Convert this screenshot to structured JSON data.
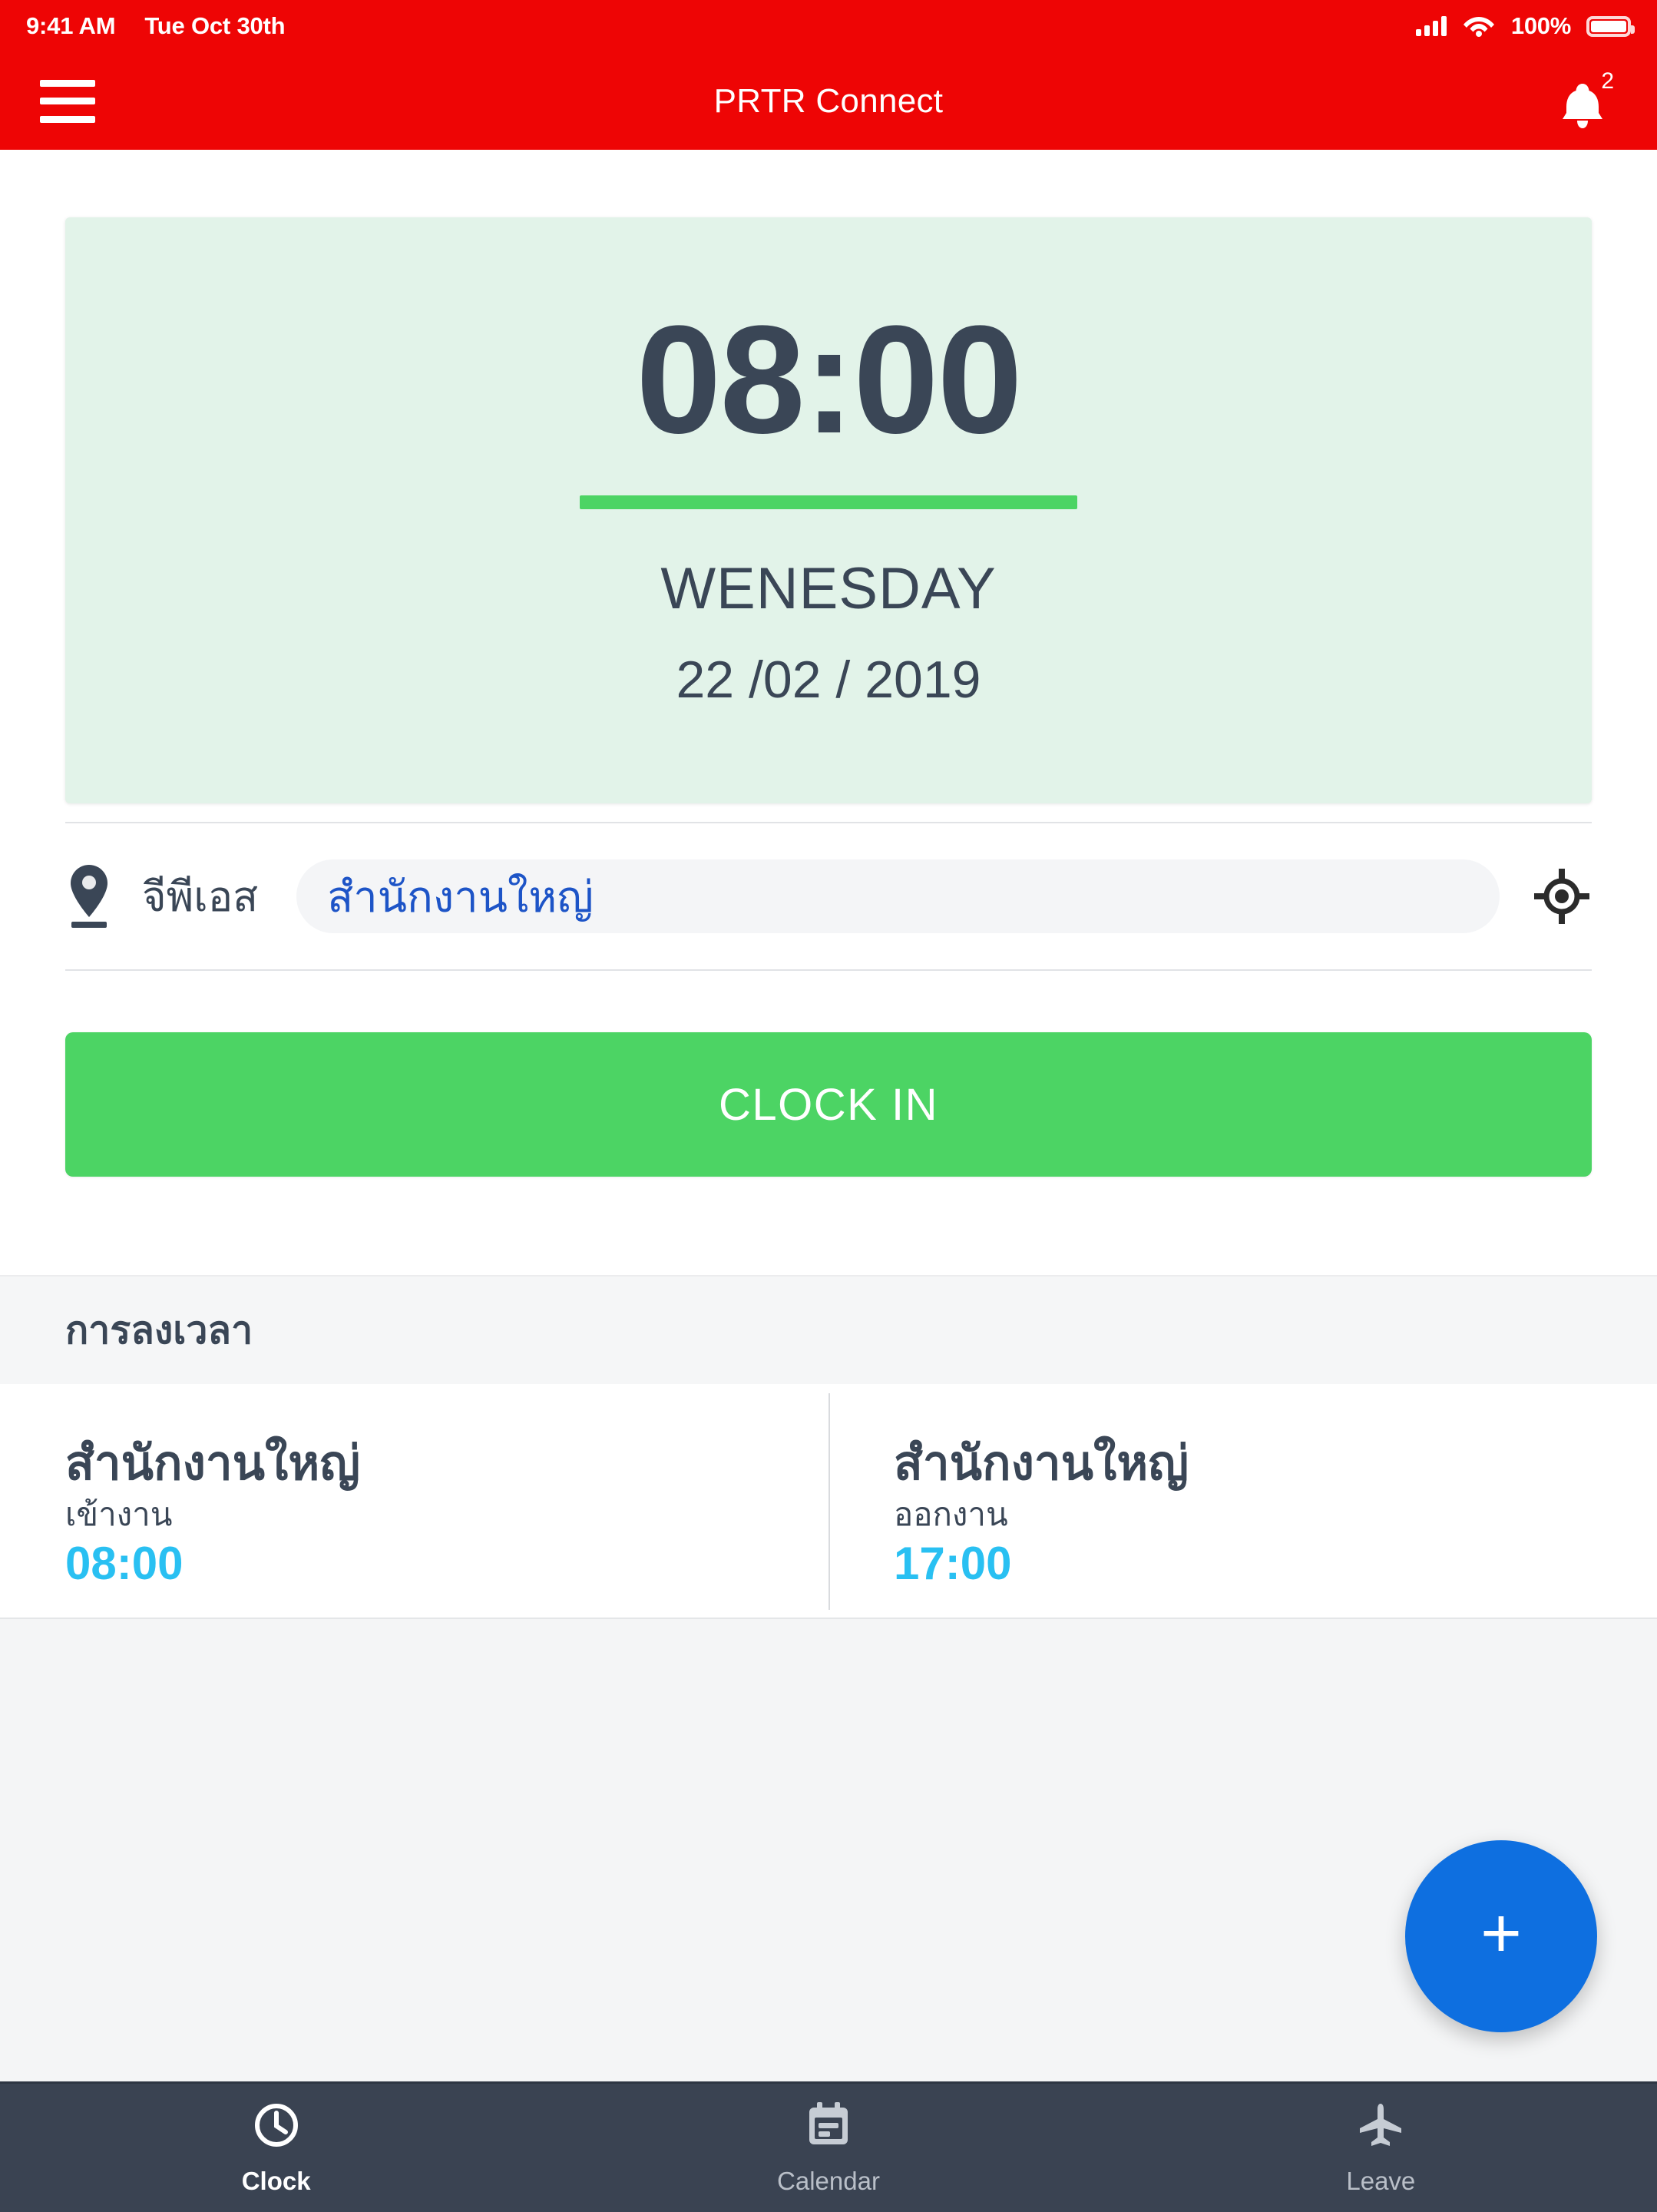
{
  "status_bar": {
    "time": "9:41 AM",
    "date": "Tue Oct 30th",
    "battery_pct": "100%",
    "signal_icon": "signal-bars-icon",
    "wifi_icon": "wifi-icon",
    "battery_icon": "battery-full-icon"
  },
  "app_bar": {
    "title": "PRTR Connect",
    "menu_icon": "hamburger-menu-icon",
    "notification_icon": "bell-icon",
    "notification_count": "2",
    "background_color": "#ee0505"
  },
  "clock_card": {
    "time": "08:00",
    "weekday": "WENESDAY",
    "date": "22 /02 / 2019",
    "background_color": "#e2f3e9",
    "accent_color": "#4cd464",
    "text_color": "#3a4656"
  },
  "gps": {
    "pin_icon": "location-pin-icon",
    "label": "จีพีเอส",
    "value": "สำนักงานใหญ่",
    "placeholder": "สำนักงานใหญ่",
    "value_color": "#1d54c7",
    "locate_icon": "gps-crosshair-icon"
  },
  "primary_action": {
    "label": "CLOCK IN",
    "color": "#4cd464"
  },
  "attendance": {
    "section_title": "การลงเวลา",
    "entries": [
      {
        "place": "สำนักงานใหญ่",
        "kind": "เข้างาน",
        "time": "08:00"
      },
      {
        "place": "สำนักงานใหญ่",
        "kind": "ออกงาน",
        "time": "17:00"
      }
    ],
    "time_color": "#29c0f2"
  },
  "fab": {
    "label": "+",
    "icon": "plus-icon",
    "color": "#0e6fe0"
  },
  "bottom_nav": {
    "background_color": "#3a4352",
    "items": [
      {
        "label": "Clock",
        "icon": "clock-icon",
        "active": true
      },
      {
        "label": "Calendar",
        "icon": "calendar-icon",
        "active": false
      },
      {
        "label": "Leave",
        "icon": "airplane-icon",
        "active": false
      }
    ]
  }
}
